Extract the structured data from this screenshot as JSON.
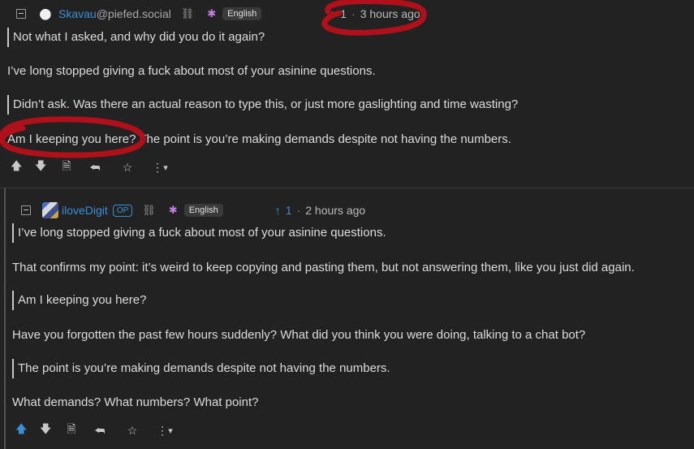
{
  "comment1": {
    "username": "Skavau",
    "instance": "@piefed.social",
    "language": "English",
    "score_arrow": "↑",
    "score": "1",
    "time": "3 hours ago",
    "quote1": "Not what I asked, and why did you do it again?",
    "para1": "I’ve long stopped giving a fuck about most of your asinine questions.",
    "quote2": "Didn’t ask. Was there an actual reason to type this, or just more gaslighting and time wasting?",
    "para2": "Am I keeping you here? The point is you’re making demands despite not having the numbers."
  },
  "comment2": {
    "username": "iloveDigit",
    "op_badge": "OP",
    "language": "English",
    "score_arrow": "↑",
    "score": "1",
    "time": "2 hours ago",
    "quote1": "I’ve long stopped giving a fuck about most of your asinine questions.",
    "para1": "That confirms my point: it’s weird to keep copying and pasting them, but not answering them, like you just did again.",
    "quote2": "Am I keeping you here?",
    "para2": "Have you forgotten the past few hours suddenly? What did you think you were doing, talking to a chat bot?",
    "quote3": "The point is you’re making demands despite not having the numbers.",
    "para3": "What demands? What numbers? What point?",
    "upvoted": true
  },
  "icons": {
    "collapse": "collapse-icon",
    "link": "link-icon",
    "language": "language-icon",
    "upvote": "arrow-up-icon",
    "downvote": "arrow-down-icon",
    "view_source": "document-icon",
    "reply": "reply-icon",
    "bookmark": "star-icon",
    "more": "more-icon"
  },
  "glyphs": {
    "up": "🡅",
    "down": "🡇",
    "doc": "🗎",
    "reply": "⮪",
    "star": "☆",
    "more": "⋮",
    "caret": "▾",
    "link": "⛓",
    "lang": "✱",
    "dot": "·"
  },
  "colors": {
    "background": "#222222",
    "text": "#dcdcdc",
    "accent": "#3b8fd9",
    "muted": "#a8a8a8",
    "annotation": "#b0101a"
  }
}
